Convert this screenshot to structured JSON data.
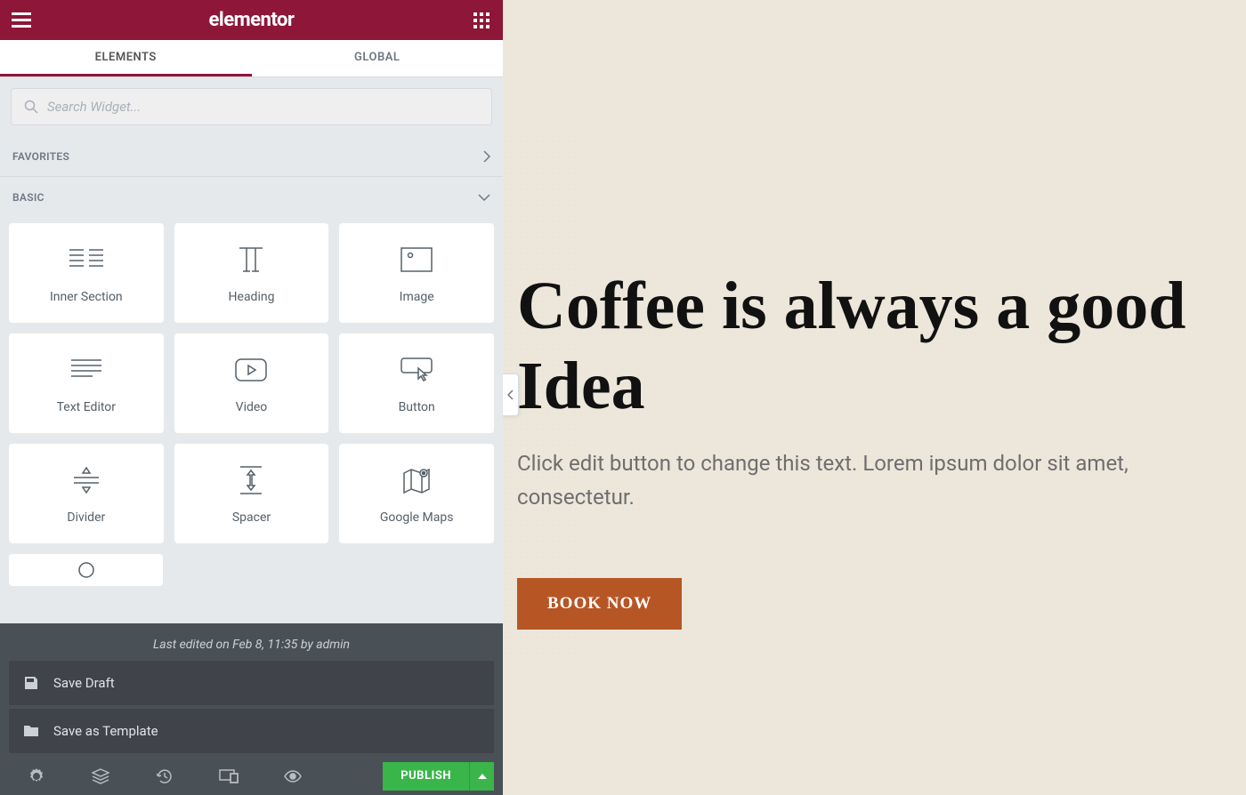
{
  "header": {
    "title": "elementor"
  },
  "tabs": {
    "elements": "ELEMENTS",
    "global": "GLOBAL"
  },
  "search": {
    "placeholder": "Search Widget..."
  },
  "categories": {
    "favorites": "FAVORITES",
    "basic": "BASIC"
  },
  "widgets": [
    {
      "label": "Inner Section",
      "icon": "inner-section"
    },
    {
      "label": "Heading",
      "icon": "heading"
    },
    {
      "label": "Image",
      "icon": "image"
    },
    {
      "label": "Text Editor",
      "icon": "text-editor"
    },
    {
      "label": "Video",
      "icon": "video"
    },
    {
      "label": "Button",
      "icon": "button"
    },
    {
      "label": "Divider",
      "icon": "divider"
    },
    {
      "label": "Spacer",
      "icon": "spacer"
    },
    {
      "label": "Google Maps",
      "icon": "maps"
    }
  ],
  "save_panel": {
    "last_edited": "Last edited on Feb 8, 11:35 by admin",
    "save_draft": "Save Draft",
    "save_template": "Save as Template"
  },
  "footer": {
    "publish": "PUBLISH"
  },
  "preview": {
    "heading": "Coffee is always a good Idea",
    "subtext": "Click edit button to change this text. Lorem ipsum dolor sit amet, consectetur.",
    "button": "BOOK NOW"
  }
}
